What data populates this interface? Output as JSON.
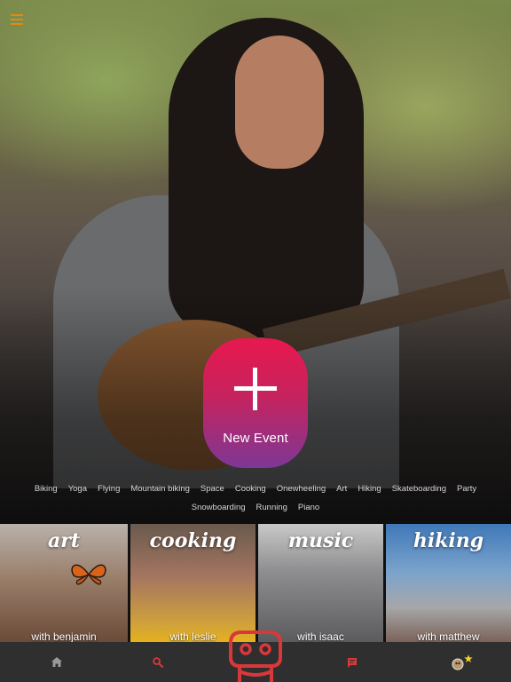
{
  "colors": {
    "accent_orange": "#e08a12",
    "button_gradient_top": "#e8184f",
    "button_gradient_bottom": "#7d3796",
    "robot_red": "#d9383b",
    "nav_bar": "#2f2f2f",
    "search_active": "#d9383b"
  },
  "header": {
    "menu_icon": "hamburger-menu-icon"
  },
  "new_event": {
    "label": "New Event",
    "icon": "plus-icon"
  },
  "tags": [
    "Biking",
    "Yoga",
    "Flying",
    "Mountain biking",
    "Space",
    "Cooking",
    "Onewheeling",
    "Art",
    "Hiking",
    "Skateboarding",
    "Party",
    "Snowboarding",
    "Running",
    "Piano"
  ],
  "cards": [
    {
      "title": "art",
      "subtitle": "with benjamin"
    },
    {
      "title": "cooking",
      "subtitle": "with leslie"
    },
    {
      "title": "music",
      "subtitle": "with isaac"
    },
    {
      "title": "hiking",
      "subtitle": "with matthew"
    }
  ],
  "bottom_nav": {
    "home_icon": "home-icon",
    "search_icon": "search-icon",
    "center_icon": "robot-logo-icon",
    "chat_icon": "chat-icon",
    "profile_icon": "avatar-icon",
    "badge_icon": "star-icon"
  }
}
